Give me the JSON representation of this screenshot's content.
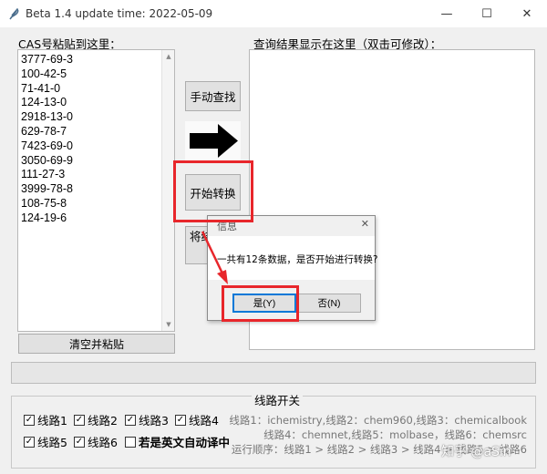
{
  "window": {
    "title": "Beta 1.4  update time: 2022-05-09",
    "minimize_glyph": "—",
    "maximize_glyph": "☐",
    "close_glyph": "✕"
  },
  "left_panel": {
    "label": "CAS号粘贴到这里：",
    "cas_items": [
      "3777-69-3",
      "100-42-5",
      "71-41-0",
      "124-13-0",
      "2918-13-0",
      "629-78-7",
      "7423-69-0",
      "3050-69-9",
      "111-27-3",
      "3999-78-8",
      "108-75-8",
      "124-19-6"
    ],
    "clear_button": "清空并粘贴"
  },
  "right_panel": {
    "label": "查询结果显示在这里（双击可修改）："
  },
  "buttons": {
    "manual": "手动查找",
    "start": "开始转换",
    "hidden_partial": "将结"
  },
  "routes": {
    "group_title": "线路开关",
    "checkboxes": [
      {
        "label": "线路1",
        "checked": true
      },
      {
        "label": "线路2",
        "checked": true
      },
      {
        "label": "线路3",
        "checked": true
      },
      {
        "label": "线路4",
        "checked": true
      },
      {
        "label": "线路5",
        "checked": true
      },
      {
        "label": "线路6",
        "checked": true
      },
      {
        "label": "若是英文自动译中",
        "checked": false
      }
    ],
    "info_line1": "线路1：ichemistry,线路2：chem960,线路3：chemicalbook",
    "info_line2": "线路4：chemnet,线路5：molbase，线路6：chemsrc",
    "info_line3": "运行顺序：线路1 > 线路2 > 线路3 > 线路4 > 线路5 > 线路6"
  },
  "dialog": {
    "title": "信息",
    "close_glyph": "✕",
    "message": "一共有12条数据，是否开始进行转换?",
    "yes": "是(Y)",
    "no": "否(N)"
  },
  "watermark": "知乎 @aSin",
  "colors": {
    "highlight": "#e8262b",
    "focus": "#0078d7"
  },
  "icons": {
    "app": "feather-icon",
    "arrow": "right-arrow-icon"
  }
}
